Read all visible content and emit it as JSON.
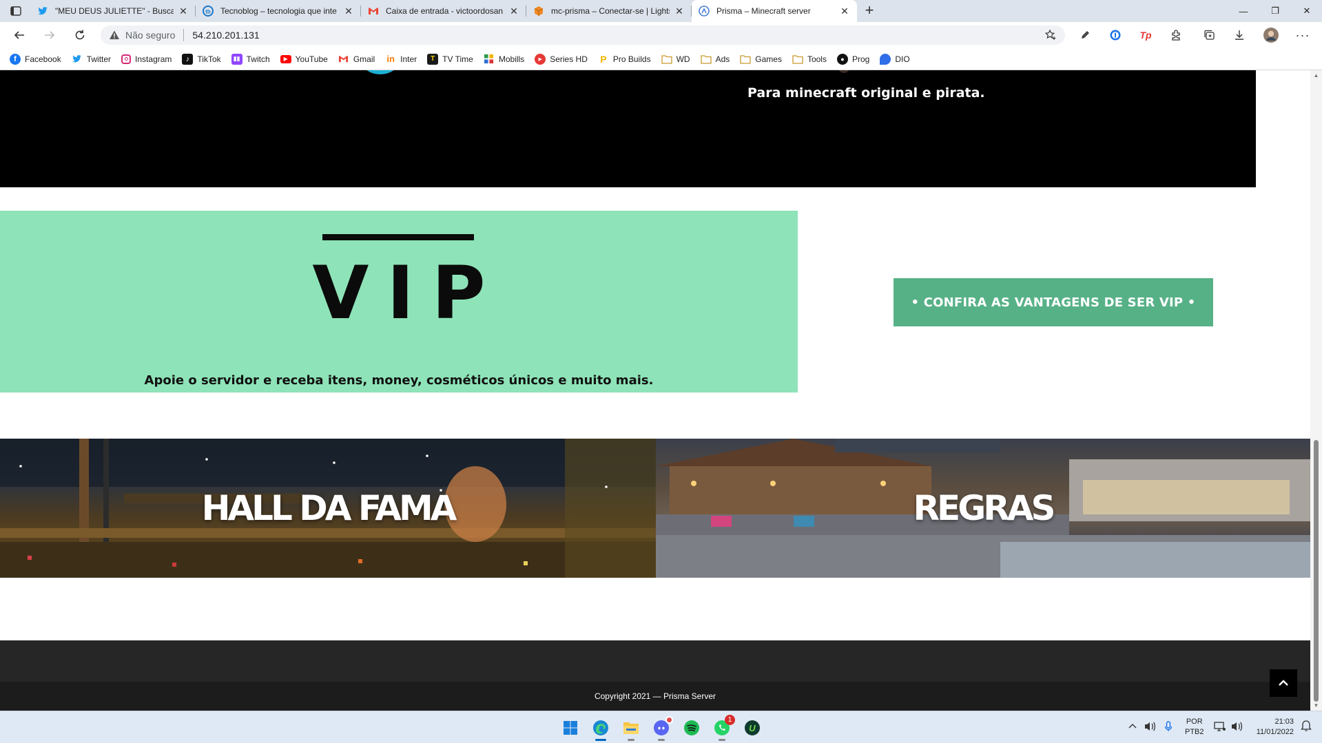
{
  "browser": {
    "tabs": [
      {
        "title": "\"MEU DEUS JULIETTE\" - Busca do",
        "icon": "twitter-icon",
        "color": "#1d9bf0"
      },
      {
        "title": "Tecnoblog – tecnologia que inte",
        "icon": "tecnoblog-icon",
        "color": "#1877c8"
      },
      {
        "title": "Caixa de entrada - victoordosan",
        "icon": "gmail-icon",
        "color": "#ea4335"
      },
      {
        "title": "mc-prisma – Conectar-se | Lights",
        "icon": "aws-cube-icon",
        "color": "#f08a24"
      },
      {
        "title": "Prisma – Minecraft server",
        "icon": "page-icon",
        "color": "#4a7fd6"
      }
    ],
    "address": {
      "security_label": "Não seguro",
      "url": "54.210.201.131"
    },
    "bookmarks": [
      {
        "label": "Facebook",
        "icon": "facebook-icon",
        "color": "#1877f2"
      },
      {
        "label": "Twitter",
        "icon": "twitter-icon",
        "color": "#1d9bf0"
      },
      {
        "label": "Instagram",
        "icon": "instagram-icon",
        "color": "#d62976"
      },
      {
        "label": "TikTok",
        "icon": "tiktok-icon",
        "color": "#111111"
      },
      {
        "label": "Twitch",
        "icon": "twitch-icon",
        "color": "#9146ff"
      },
      {
        "label": "YouTube",
        "icon": "youtube-icon",
        "color": "#ff0000"
      },
      {
        "label": "Gmail",
        "icon": "gmail-icon",
        "color": "#ea4335"
      },
      {
        "label": "Inter",
        "icon": "inter-icon",
        "color": "#ff7a00"
      },
      {
        "label": "TV Time",
        "icon": "tvtime-icon",
        "color": "#1a1a1a"
      },
      {
        "label": "Mobills",
        "icon": "mobills-icon",
        "color": "#2e9a4a"
      },
      {
        "label": "Series HD",
        "icon": "play-icon",
        "color": "#e53935"
      },
      {
        "label": "Pro Builds",
        "icon": "probuilds-icon",
        "color": "#f2b400"
      },
      {
        "label": "WD",
        "icon": "folder-icon",
        "color": "#e8b84a"
      },
      {
        "label": "Ads",
        "icon": "folder-icon",
        "color": "#e8b84a"
      },
      {
        "label": "Games",
        "icon": "folder-icon",
        "color": "#e8b84a"
      },
      {
        "label": "Tools",
        "icon": "folder-icon",
        "color": "#e8b84a"
      },
      {
        "label": "Prog",
        "icon": "github-icon",
        "color": "#111111"
      },
      {
        "label": "DIO",
        "icon": "dio-icon",
        "color": "#2f6ee8"
      }
    ]
  },
  "page": {
    "hero_text": "Para minecraft original e pirata.",
    "vip": {
      "title": "VIP",
      "subtitle": "Apoie o servidor e receba itens, money, cosméticos únicos e muito mais.",
      "button_label": "• CONFIRA AS VANTAGENS DE SER VIP •",
      "background_color": "#8ee3b8",
      "button_color": "#57b187"
    },
    "cards": [
      {
        "title": "HALL DA FAMA"
      },
      {
        "title": "REGRAS"
      }
    ],
    "footer": {
      "copyright": "Copyright 2021 — Prisma Server"
    }
  },
  "taskbar": {
    "apps": [
      {
        "name": "windows-start-icon"
      },
      {
        "name": "edge-icon"
      },
      {
        "name": "file-explorer-icon"
      },
      {
        "name": "discord-icon"
      },
      {
        "name": "spotify-icon"
      },
      {
        "name": "whatsapp-icon",
        "badge": "1"
      },
      {
        "name": "upwork-icon"
      }
    ],
    "language": {
      "line1": "POR",
      "line2": "PTB2"
    },
    "clock": {
      "time": "21:03",
      "date": "11/01/2022"
    }
  }
}
